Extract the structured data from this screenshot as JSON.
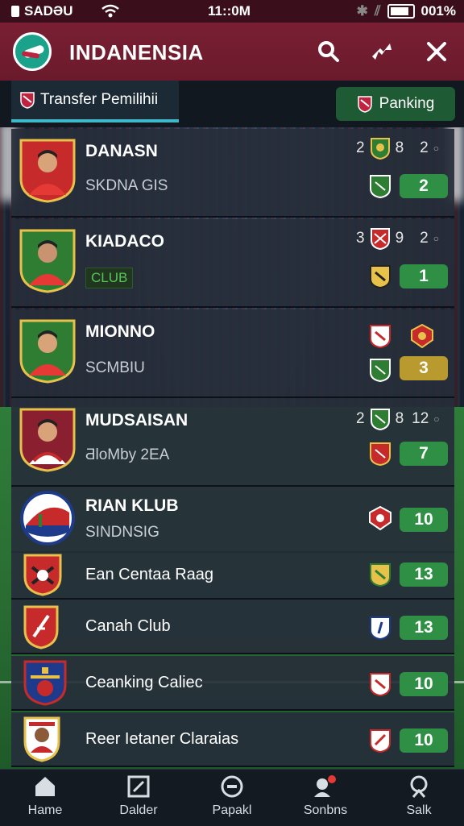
{
  "status_bar": {
    "carrier": "SADƏU",
    "time": "11::0M",
    "battery": "001%"
  },
  "header": {
    "title": "INDANENSIA"
  },
  "tabs": {
    "transfer": "Transfer Pemilihii",
    "ranking": "Panking"
  },
  "rows": [
    {
      "name": "DANASN",
      "sub": "SKDNA GIS",
      "stat_left": "2",
      "stat_mid": "8",
      "stat_right": "2",
      "pill": "2",
      "pill_color": "#2e8f45"
    },
    {
      "name": "KIADACO",
      "sub": "CLUB",
      "stat_left": "3",
      "stat_mid": "9",
      "stat_right": "2",
      "pill": "1",
      "pill_color": "#2e8f45"
    },
    {
      "name": "MIONNO",
      "sub": "SCMBIU",
      "stat_left": "",
      "stat_mid": "",
      "stat_right": "",
      "pill": "3",
      "pill_color": "#b99a2e"
    },
    {
      "name": "MUDSAISAN",
      "sub": "ƋloMby 2EA",
      "stat_left": "2",
      "stat_mid": "8",
      "stat_right": "12",
      "pill": "7",
      "pill_color": "#2e8f45"
    },
    {
      "name": "RIAN KLUB",
      "sub": "SINDNSIG",
      "pill": "10"
    },
    {
      "name": "Ean Centaa Raag",
      "pill": "13"
    },
    {
      "name": "Canah Club",
      "pill": "13"
    },
    {
      "name": "Ceanking Caliec",
      "pill": "10"
    },
    {
      "name": "Reer Ietaner Claraias",
      "pill": "10"
    }
  ],
  "nav": {
    "home": "Hame",
    "dalder": "Dalder",
    "papakl": "Papakl",
    "sonbns": "Sonbns",
    "salk": "Salk"
  },
  "colors": {
    "header": "#7a1f33",
    "accent": "#3fb8c9",
    "pill_green": "#2e8f45",
    "pill_gold": "#b99a2e"
  }
}
